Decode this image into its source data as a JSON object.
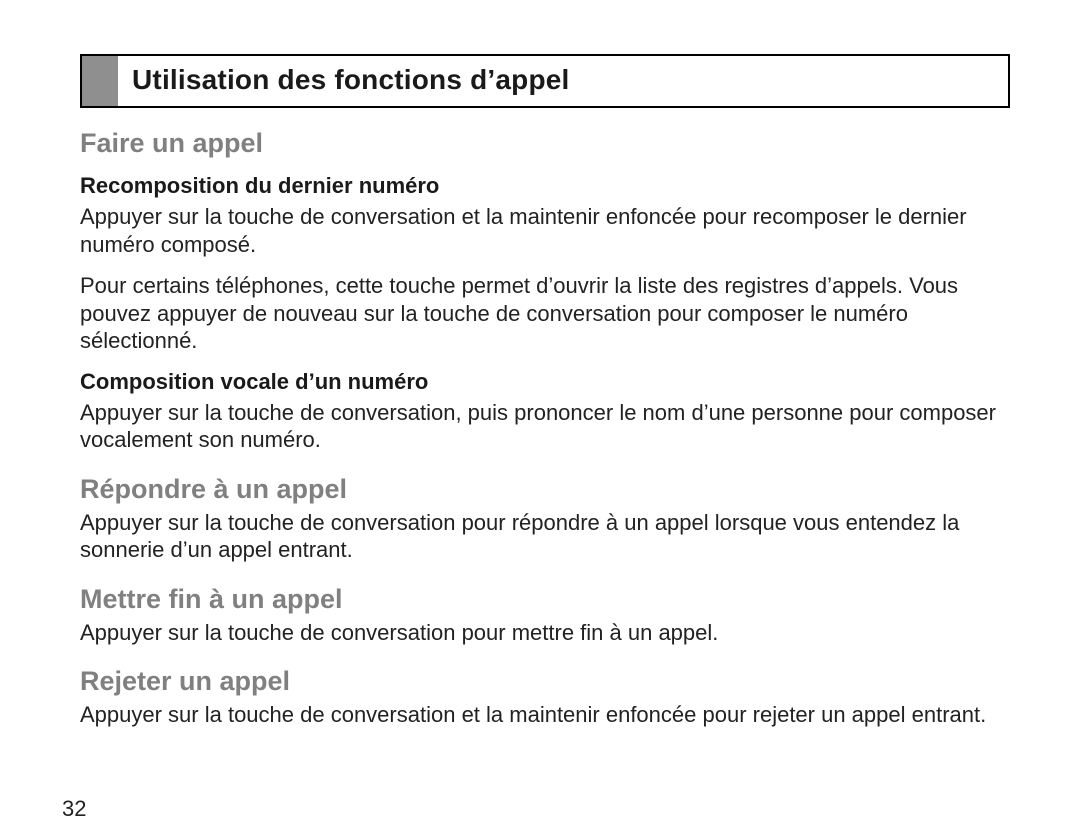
{
  "title": "Utilisation des fonctions d’appel",
  "sections": [
    {
      "heading": "Faire un appel",
      "subs": [
        {
          "subheading": "Recomposition du dernier numéro",
          "paras": [
            "Appuyer sur la touche de conversation et la maintenir enfoncée pour recomposer le dernier numéro composé.",
            "Pour certains téléphones, cette touche permet d’ouvrir la liste des registres d’appels. Vous pouvez appuyer de nouveau sur la touche de conversation pour composer le numéro sélectionné."
          ]
        },
        {
          "subheading": "Composition vocale d’un numéro",
          "paras": [
            "Appuyer sur la touche de conversation, puis prononcer le nom d’une personne pour composer vocalement son numéro."
          ]
        }
      ]
    },
    {
      "heading": "Répondre à un appel",
      "paras": [
        "Appuyer sur la touche de conversation pour répondre à un appel lorsque vous entendez la sonnerie d’un appel entrant."
      ]
    },
    {
      "heading": "Mettre fin à un appel",
      "paras": [
        "Appuyer sur la touche de conversation pour mettre fin à un appel."
      ]
    },
    {
      "heading": "Rejeter un appel",
      "paras": [
        "Appuyer sur la touche de conversation et la maintenir enfoncée pour rejeter un appel entrant."
      ]
    }
  ],
  "page_number": "32"
}
